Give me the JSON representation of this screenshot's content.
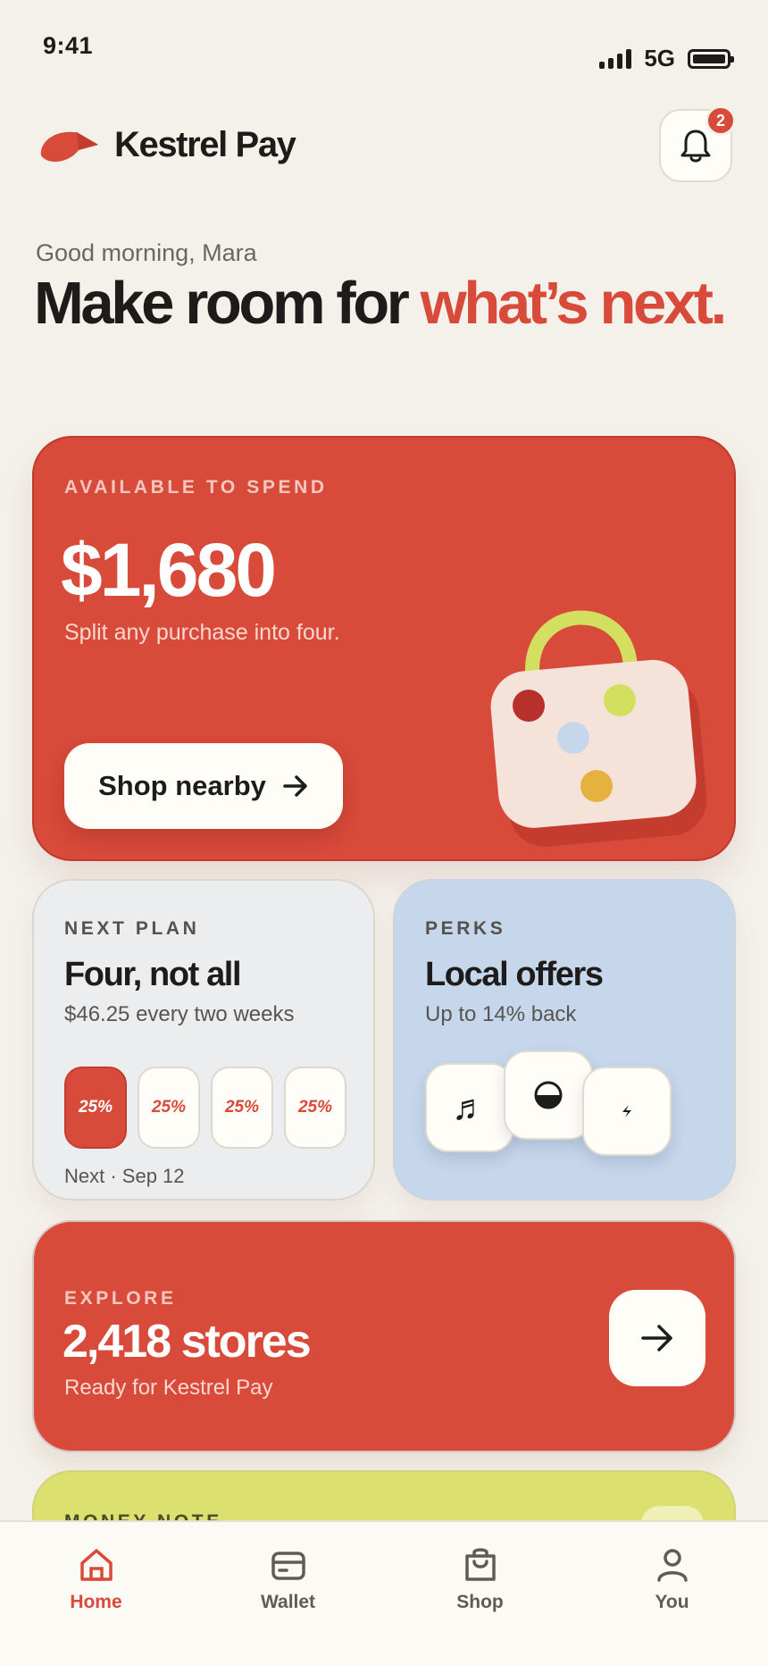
{
  "status": {
    "time": "9:41",
    "network": "5G"
  },
  "header": {
    "brand": "Kestrel Pay",
    "notifications_count": "2"
  },
  "greeting": "Good morning, Mara",
  "headline": {
    "main": "Make room for ",
    "accent": "what’s next."
  },
  "hero": {
    "eyebrow": "AVAILABLE TO SPEND",
    "amount": "$1,680",
    "subtitle": "Split any purchase into four.",
    "button_label": "Shop nearby"
  },
  "plan": {
    "eyebrow": "NEXT PLAN",
    "title": "Four, not all",
    "subtitle": "$46.25 every two weeks",
    "installments": [
      "25%",
      "25%",
      "25%",
      "25%"
    ],
    "next": "Next · Sep 12"
  },
  "perks": {
    "eyebrow": "PERKS",
    "title": "Local offers",
    "subtitle": "Up to 14% back",
    "tiles": [
      "music-icon",
      "half-circle-icon",
      "bolt-icon"
    ]
  },
  "explore": {
    "eyebrow": "EXPLORE",
    "count": "2,418 stores",
    "subtitle": "Ready for Kestrel Pay"
  },
  "money_note": {
    "eyebrow": "MONEY NOTE"
  },
  "tabs": [
    {
      "label": "Home",
      "icon": "home-icon",
      "active": true
    },
    {
      "label": "Wallet",
      "icon": "wallet-icon",
      "active": false
    },
    {
      "label": "Shop",
      "icon": "shopping-bag-icon",
      "active": false
    },
    {
      "label": "You",
      "icon": "person-icon",
      "active": false
    }
  ],
  "colors": {
    "accent": "#d84a3a",
    "background": "#f4f1eb",
    "perks": "#c6d6eb",
    "money": "#dbe06e"
  }
}
